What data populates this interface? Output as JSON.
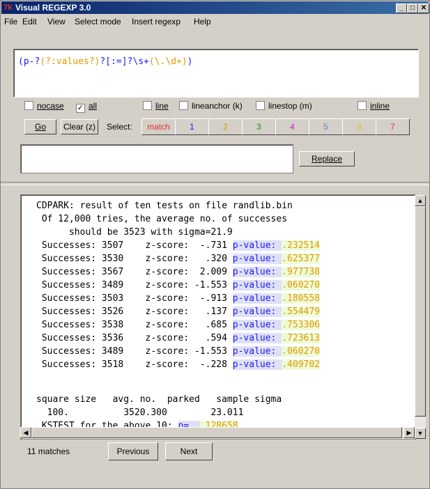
{
  "window": {
    "title": "Visual REGEXP 3.0",
    "app_icon": "tk-feather-icon"
  },
  "menu": [
    "File",
    "Edit",
    "View",
    "Select mode",
    "Insert regexp",
    "Help"
  ],
  "regex": {
    "p1": "(p-?",
    "p2": "(?:values?)",
    "p3": "?[:=]?\\s+",
    "p4": "(\\.\\d+)",
    "p5": ")"
  },
  "options": {
    "nocase": {
      "label": "nocase",
      "checked": false
    },
    "all": {
      "label": "all",
      "checked": true
    },
    "line": {
      "label": "line",
      "checked": false
    },
    "lineanchor": {
      "label": "lineanchor (k)",
      "checked": false
    },
    "linestop": {
      "label": "linestop (m)",
      "checked": false
    },
    "inline": {
      "label": "inline",
      "checked": false
    }
  },
  "buttons": {
    "go": "Go",
    "clear": "Clear (z)",
    "select_label": "Select:",
    "replace": "Replace",
    "previous": "Previous",
    "next": "Next"
  },
  "select_buttons": [
    {
      "label": "match",
      "color": "#e03030"
    },
    {
      "label": "1",
      "color": "#1a1aff"
    },
    {
      "label": "2",
      "color": "#e09a00"
    },
    {
      "label": "3",
      "color": "#109010"
    },
    {
      "label": "4",
      "color": "#d020d0"
    },
    {
      "label": "5",
      "color": "#6080c0"
    },
    {
      "label": "6",
      "color": "#e0c020"
    },
    {
      "label": "7",
      "color": "#e03030"
    }
  ],
  "replace_value": "",
  "output": {
    "header": [
      "CDPARK: result of ten tests on file randlib.bin",
      " Of 12,000 tries, the average no. of successes",
      "      should be 3523 with sigma=21.9"
    ],
    "rows": [
      {
        "text": " Successes: 3507    z-score:  -.731 ",
        "label": "p-value:",
        "value": ".232514"
      },
      {
        "text": " Successes: 3530    z-score:   .320 ",
        "label": "p-value:",
        "value": ".625377"
      },
      {
        "text": " Successes: 3567    z-score:  2.009 ",
        "label": "p-value:",
        "value": ".977738"
      },
      {
        "text": " Successes: 3489    z-score: -1.553 ",
        "label": "p-value:",
        "value": ".060270"
      },
      {
        "text": " Successes: 3503    z-score:  -.913 ",
        "label": "p-value:",
        "value": ".180558"
      },
      {
        "text": " Successes: 3526    z-score:   .137 ",
        "label": "p-value:",
        "value": ".554479"
      },
      {
        "text": " Successes: 3538    z-score:   .685 ",
        "label": "p-value:",
        "value": ".753306"
      },
      {
        "text": " Successes: 3536    z-score:   .594 ",
        "label": "p-value:",
        "value": ".723613"
      },
      {
        "text": " Successes: 3489    z-score: -1.553 ",
        "label": "p-value:",
        "value": ".060270"
      },
      {
        "text": " Successes: 3518    z-score:  -.228 ",
        "label": "p-value:",
        "value": ".409702"
      }
    ],
    "summary_header": "square size   avg. no.  parked   sample sigma",
    "summary_values": "  100.          3520.300        23.011",
    "kstest_text": " KSTEST for the above 10: ",
    "kstest_label": "p=",
    "kstest_value": ".128658"
  },
  "status": {
    "matches": "11 matches"
  },
  "colors": {
    "group1": "#1a1aff",
    "group2": "#e09a00",
    "match_bg_blue": "#dfe0f6",
    "match_bg_green": "#eefbd6"
  }
}
